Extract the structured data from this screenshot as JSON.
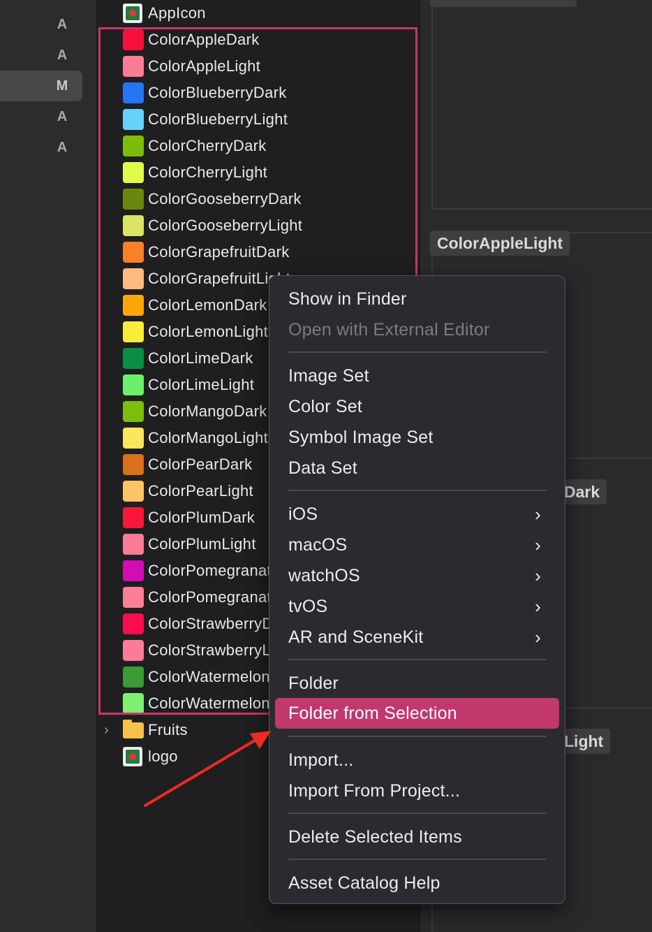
{
  "gutter": {
    "letters": [
      "A",
      "A",
      "M",
      "A",
      "A"
    ]
  },
  "list": {
    "appicon": "AppIcon",
    "colors": [
      {
        "name": "ColorAppleDark",
        "color": "#f5103a"
      },
      {
        "name": "ColorAppleLight",
        "color": "#fb7d95"
      },
      {
        "name": "ColorBlueberryDark",
        "color": "#2775f5"
      },
      {
        "name": "ColorBlueberryLight",
        "color": "#65d3fb"
      },
      {
        "name": "ColorCherryDark",
        "color": "#7cbc0c"
      },
      {
        "name": "ColorCherryLight",
        "color": "#dffb4d"
      },
      {
        "name": "ColorGooseberryDark",
        "color": "#6a870f"
      },
      {
        "name": "ColorGooseberryLight",
        "color": "#dde366"
      },
      {
        "name": "ColorGrapefruitDark",
        "color": "#f88026"
      },
      {
        "name": "ColorGrapefruitLight",
        "color": "#fdbb7e"
      },
      {
        "name": "ColorLemonDark",
        "color": "#fda60c"
      },
      {
        "name": "ColorLemonLight",
        "color": "#fbec3a"
      },
      {
        "name": "ColorLimeDark",
        "color": "#088f44"
      },
      {
        "name": "ColorLimeLight",
        "color": "#6cf06a"
      },
      {
        "name": "ColorMangoDark",
        "color": "#7dbd0d"
      },
      {
        "name": "ColorMangoLight",
        "color": "#fde65c"
      },
      {
        "name": "ColorPearDark",
        "color": "#d8701c"
      },
      {
        "name": "ColorPearLight",
        "color": "#fdc467"
      },
      {
        "name": "ColorPlumDark",
        "color": "#f7173c"
      },
      {
        "name": "ColorPlumLight",
        "color": "#fb7a96"
      },
      {
        "name": "ColorPomegranateDark",
        "color": "#d40cb3"
      },
      {
        "name": "ColorPomegranateLight",
        "color": "#fb7f95"
      },
      {
        "name": "ColorStrawberryDark",
        "color": "#fa0d4c"
      },
      {
        "name": "ColorStrawberryLight",
        "color": "#fb7c96"
      },
      {
        "name": "ColorWatermelonDark",
        "color": "#3a9b37"
      },
      {
        "name": "ColorWatermelonLight",
        "color": "#7bf173"
      }
    ],
    "folder": "Fruits",
    "logo": "logo",
    "selection_color": "#c8376b"
  },
  "right": {
    "label_top": "ColorAppleLight",
    "label_mid": "Dark",
    "label_bottom": "Light"
  },
  "menu": {
    "items": [
      {
        "label": "Show in Finder"
      },
      {
        "label": "Open with External Editor",
        "disabled": true
      },
      {
        "label": "Image Set"
      },
      {
        "label": "Color Set"
      },
      {
        "label": "Symbol Image Set"
      },
      {
        "label": "Data Set"
      },
      {
        "label": "iOS",
        "submenu": true
      },
      {
        "label": "macOS",
        "submenu": true
      },
      {
        "label": "watchOS",
        "submenu": true
      },
      {
        "label": "tvOS",
        "submenu": true
      },
      {
        "label": "AR and SceneKit",
        "submenu": true
      },
      {
        "label": "Folder"
      },
      {
        "label": "Folder from Selection",
        "highlighted": true
      },
      {
        "label": "Import..."
      },
      {
        "label": "Import From Project..."
      },
      {
        "label": "Delete Selected Items"
      },
      {
        "label": "Asset Catalog Help"
      }
    ],
    "submenu_glyph": "›",
    "highlight_color": "#c1386d"
  },
  "annotation": {
    "arrow_color": "#ee2b1f"
  }
}
